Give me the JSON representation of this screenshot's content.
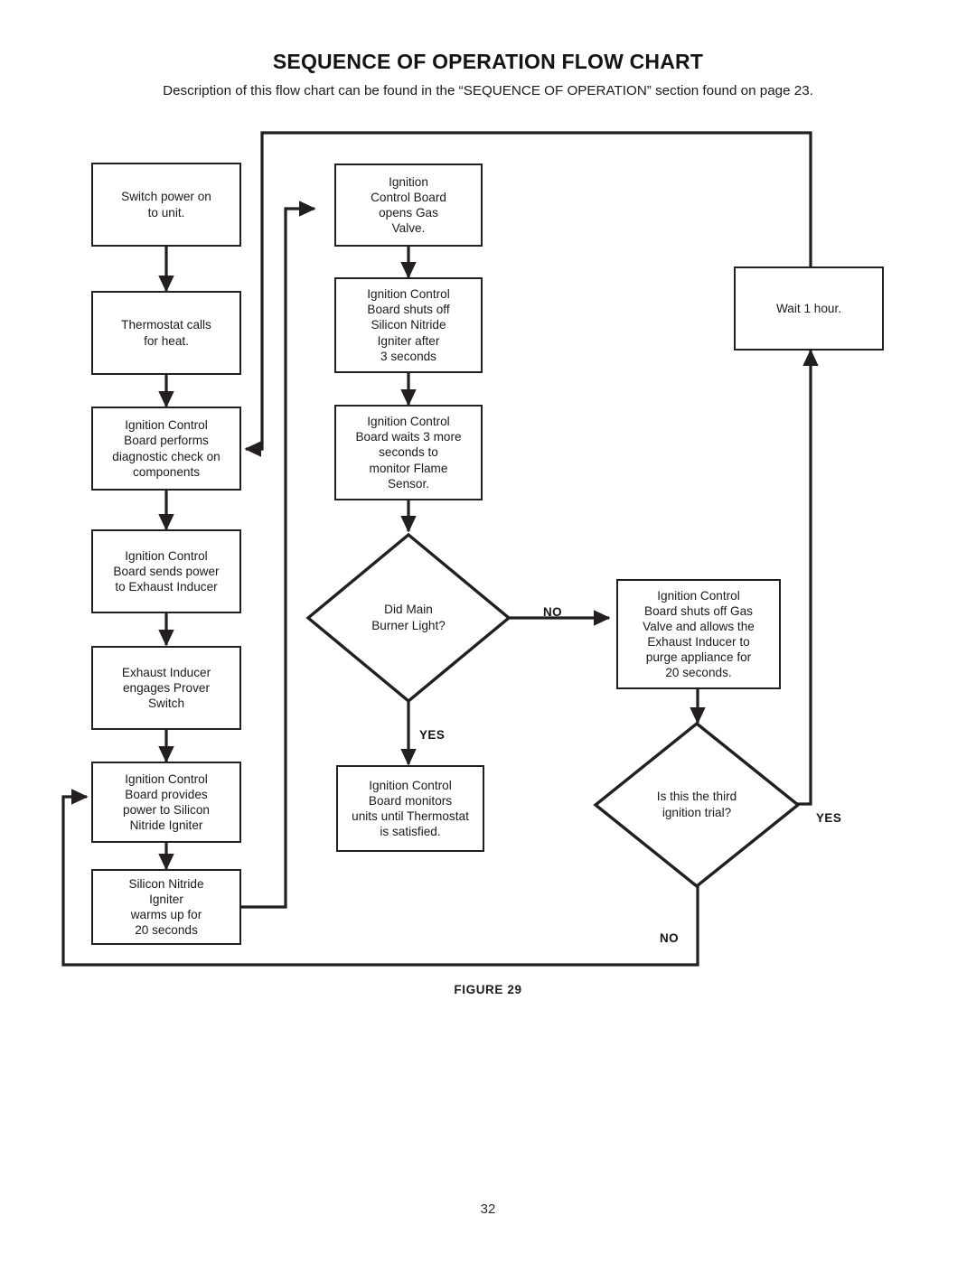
{
  "header": {
    "title": "SEQUENCE OF OPERATION FLOW CHART",
    "subtitle": "Description of this flow chart can be found in the “SEQUENCE OF OPERATION” section found on page 23."
  },
  "footer": {
    "figure_label": "FIGURE 29",
    "page_number": "32"
  },
  "colors": {
    "line": "#231f20",
    "text": "#1a1a1a",
    "background": "#ffffff"
  },
  "chart_data": {
    "type": "diagram",
    "title": "SEQUENCE OF OPERATION FLOW CHART",
    "nodes": [
      {
        "id": "n1",
        "shape": "process",
        "text": "Switch power on\nto unit."
      },
      {
        "id": "n2",
        "shape": "process",
        "text": "Thermostat calls\nfor heat."
      },
      {
        "id": "n3",
        "shape": "process",
        "text": "Ignition Control\nBoard performs\ndiagnostic check on\ncomponents"
      },
      {
        "id": "n4",
        "shape": "process",
        "text": "Ignition Control\nBoard sends power\nto Exhaust Inducer"
      },
      {
        "id": "n5",
        "shape": "process",
        "text": "Exhaust Inducer\nengages Prover\nSwitch"
      },
      {
        "id": "n6",
        "shape": "process",
        "text": "Ignition Control\nBoard provides\npower to Silicon\nNitride Igniter"
      },
      {
        "id": "n7",
        "shape": "process",
        "text": "Silicon Nitride\nIgniter\nwarms up for\n20 seconds"
      },
      {
        "id": "n8",
        "shape": "process",
        "text": "Ignition\nControl Board\nopens Gas\nValve."
      },
      {
        "id": "n9",
        "shape": "process",
        "text": "Ignition Control\nBoard shuts off\nSilicon Nitride\nIgniter after\n3 seconds"
      },
      {
        "id": "n10",
        "shape": "process",
        "text": "Ignition Control\nBoard waits 3 more\nseconds to\nmonitor Flame\nSensor."
      },
      {
        "id": "d1",
        "shape": "decision",
        "text": "Did Main\nBurner Light?"
      },
      {
        "id": "n11",
        "shape": "process",
        "text": "Ignition Control\nBoard monitors\nunits until Thermostat\nis satisfied."
      },
      {
        "id": "n12",
        "shape": "process",
        "text": "Ignition Control\nBoard shuts off Gas\nValve and allows the\nExhaust Inducer to\npurge appliance for\n20 seconds."
      },
      {
        "id": "d2",
        "shape": "decision",
        "text": "Is this the third\nignition trial?"
      },
      {
        "id": "n13",
        "shape": "process",
        "text": "Wait 1 hour."
      }
    ],
    "edges": [
      {
        "from": "n1",
        "to": "n2",
        "label": ""
      },
      {
        "from": "n2",
        "to": "n3",
        "label": ""
      },
      {
        "from": "n3",
        "to": "n4",
        "label": ""
      },
      {
        "from": "n4",
        "to": "n5",
        "label": ""
      },
      {
        "from": "n5",
        "to": "n6",
        "label": ""
      },
      {
        "from": "n6",
        "to": "n7",
        "label": ""
      },
      {
        "from": "n7",
        "to": "n8",
        "label": ""
      },
      {
        "from": "n8",
        "to": "n9",
        "label": ""
      },
      {
        "from": "n9",
        "to": "n10",
        "label": ""
      },
      {
        "from": "n10",
        "to": "d1",
        "label": ""
      },
      {
        "from": "d1",
        "to": "n11",
        "label": "YES"
      },
      {
        "from": "d1",
        "to": "n12",
        "label": "NO"
      },
      {
        "from": "n12",
        "to": "d2",
        "label": ""
      },
      {
        "from": "d2",
        "to": "n13",
        "label": "YES"
      },
      {
        "from": "d2",
        "to": "n6",
        "label": "NO"
      },
      {
        "from": "n13",
        "to": "n3",
        "label": ""
      }
    ],
    "branch_labels": [
      {
        "id": "lbl_no_1",
        "text": "NO"
      },
      {
        "id": "lbl_yes_1",
        "text": "YES"
      },
      {
        "id": "lbl_yes_2",
        "text": "YES"
      },
      {
        "id": "lbl_no_2",
        "text": "NO"
      }
    ]
  }
}
